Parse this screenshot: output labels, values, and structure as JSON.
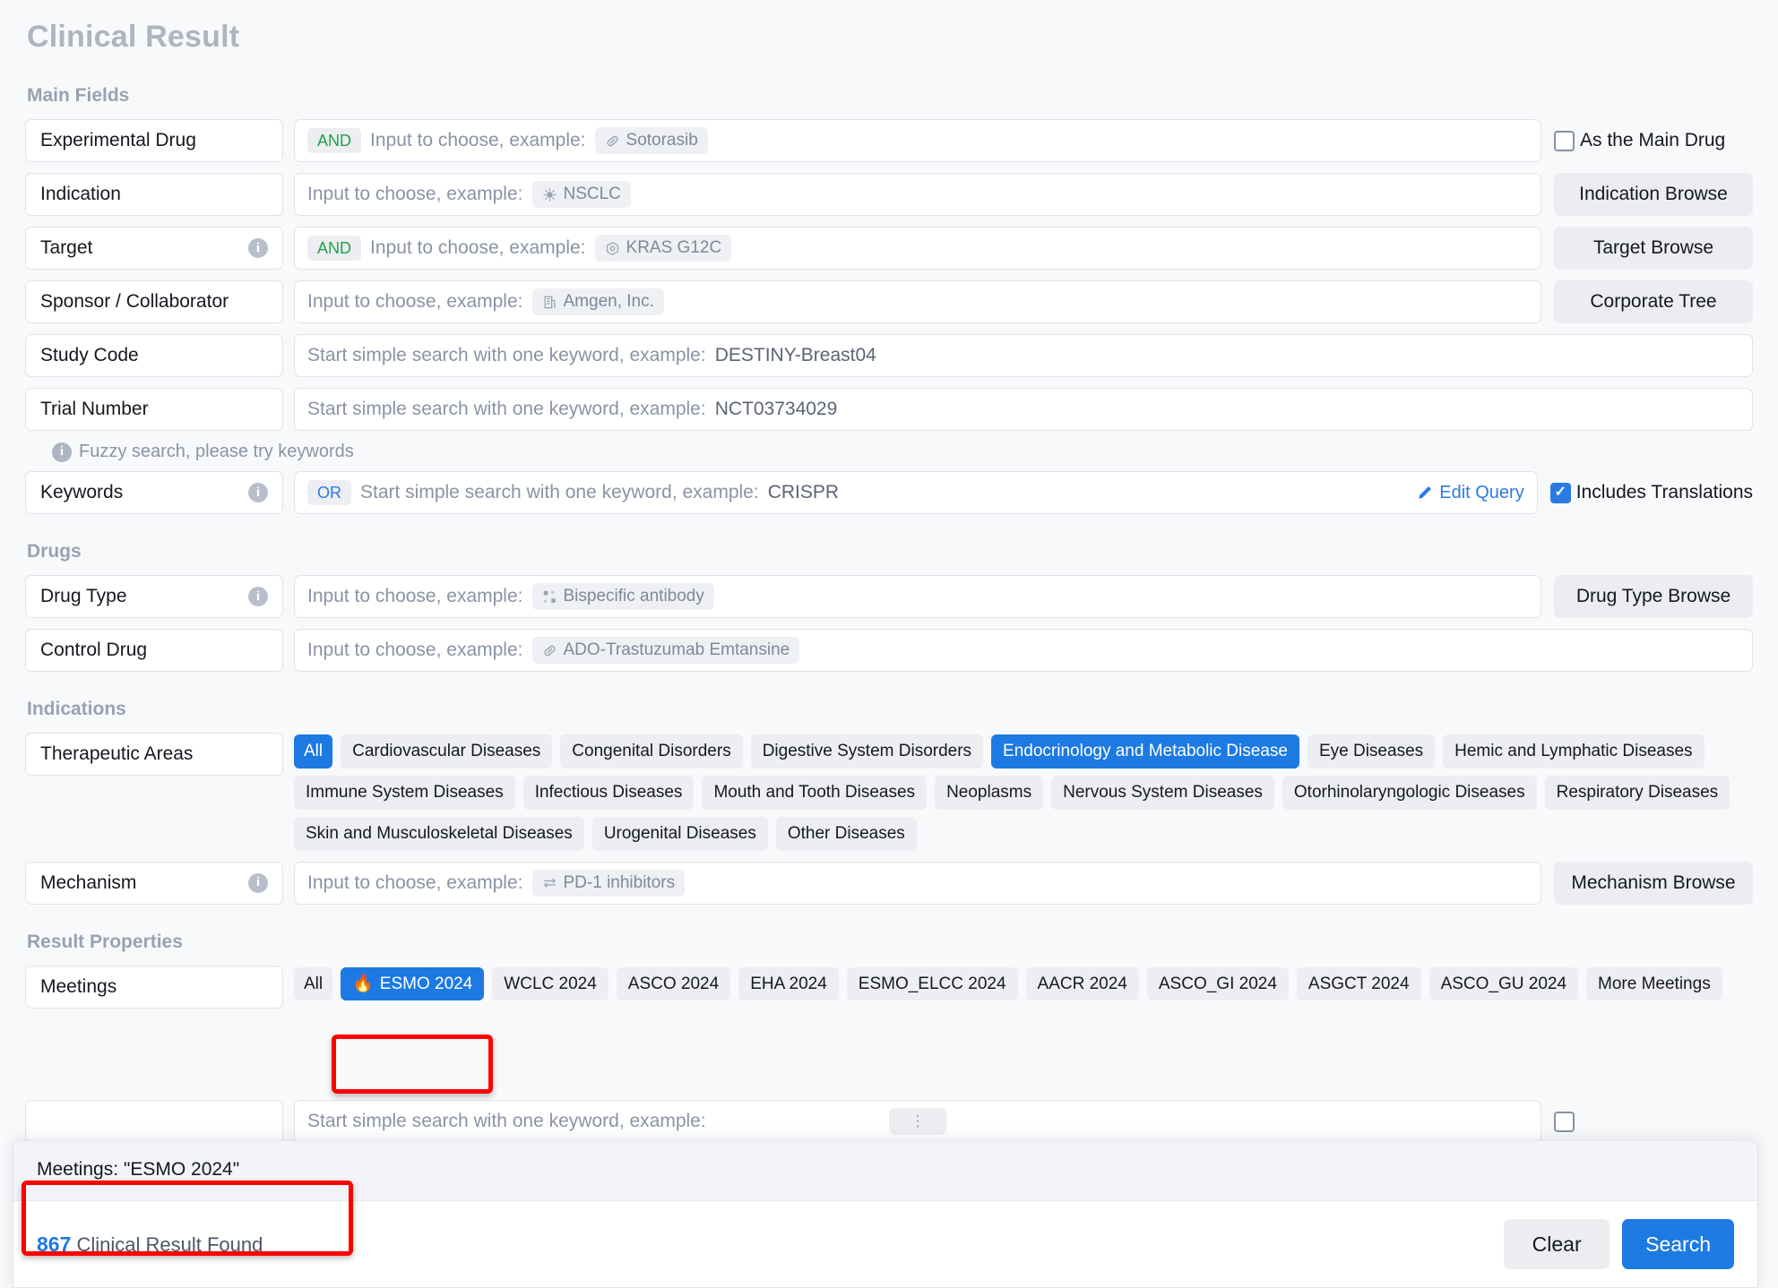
{
  "page": {
    "title": "Clinical Result"
  },
  "sections": {
    "main_fields": {
      "title": "Main Fields"
    },
    "drugs": {
      "title": "Drugs"
    },
    "indications": {
      "title": "Indications"
    },
    "result_properties": {
      "title": "Result Properties"
    }
  },
  "common": {
    "input_to_choose": "Input to choose, example:",
    "simple_search": "Start simple search with one keyword, example:",
    "info_icon": "info-icon"
  },
  "fields": {
    "experimental_drug": {
      "label": "Experimental Drug",
      "logic": "AND",
      "placeholder": "Input to choose, example:",
      "example": "Sotorasib",
      "example_icon": "pill-icon",
      "checkbox_label": "As the Main Drug",
      "checkbox_checked": false
    },
    "indication": {
      "label": "Indication",
      "placeholder": "Input to choose, example:",
      "example": "NSCLC",
      "example_icon": "virus-icon",
      "button": "Indication Browse"
    },
    "target": {
      "label": "Target",
      "logic": "AND",
      "placeholder": "Input to choose, example:",
      "example": "KRAS G12C",
      "example_icon": "target-icon",
      "button": "Target Browse"
    },
    "sponsor": {
      "label": "Sponsor / Collaborator",
      "placeholder": "Input to choose, example:",
      "example": "Amgen, Inc.",
      "example_icon": "building-icon",
      "button": "Corporate Tree"
    },
    "study_code": {
      "label": "Study Code",
      "placeholder": "Start simple search with one keyword, example:",
      "example": "DESTINY-Breast04"
    },
    "trial_number": {
      "label": "Trial Number",
      "placeholder": "Start simple search with one keyword, example:",
      "example": "NCT03734029"
    },
    "fuzzy_hint": "Fuzzy search, please try keywords",
    "keywords": {
      "label": "Keywords",
      "logic": "OR",
      "placeholder": "Start simple search with one keyword, example:",
      "example": "CRISPR",
      "edit_query": "Edit Query",
      "checkbox_label": "Includes Translations",
      "checkbox_checked": true
    },
    "drug_type": {
      "label": "Drug Type",
      "placeholder": "Input to choose, example:",
      "example": "Bispecific antibody",
      "example_icon": "molecule-icon",
      "button": "Drug Type Browse"
    },
    "control_drug": {
      "label": "Control Drug",
      "placeholder": "Input to choose, example:",
      "example": "ADO-Trastuzumab Emtansine",
      "example_icon": "pill-icon"
    },
    "therapeutic_areas": {
      "label": "Therapeutic Areas"
    },
    "mechanism": {
      "label": "Mechanism",
      "placeholder": "Input to choose, example:",
      "example": "PD-1 inhibitors",
      "example_icon": "equilibrium-icon",
      "button": "Mechanism Browse"
    },
    "meetings": {
      "label": "Meetings"
    }
  },
  "therapeutic_area_tags": [
    {
      "label": "All",
      "active": true
    },
    {
      "label": "Cardiovascular Diseases",
      "active": false
    },
    {
      "label": "Congenital Disorders",
      "active": false
    },
    {
      "label": "Digestive System Disorders",
      "active": false
    },
    {
      "label": "Endocrinology and Metabolic Disease",
      "active": true
    },
    {
      "label": "Eye Diseases",
      "active": false
    },
    {
      "label": "Hemic and Lymphatic Diseases",
      "active": false
    },
    {
      "label": "Immune System Diseases",
      "active": false
    },
    {
      "label": "Infectious Diseases",
      "active": false
    },
    {
      "label": "Mouth and Tooth Diseases",
      "active": false
    },
    {
      "label": "Neoplasms",
      "active": false
    },
    {
      "label": "Nervous System Diseases",
      "active": false
    },
    {
      "label": "Otorhinolaryngologic Diseases",
      "active": false
    },
    {
      "label": "Respiratory Diseases",
      "active": false
    },
    {
      "label": "Skin and Musculoskeletal Diseases",
      "active": false
    },
    {
      "label": "Urogenital Diseases",
      "active": false
    },
    {
      "label": "Other Diseases",
      "active": false
    }
  ],
  "meeting_tags": [
    {
      "label": "All",
      "active": false,
      "icon": ""
    },
    {
      "label": "ESMO 2024",
      "active": true,
      "icon": "fire-icon"
    },
    {
      "label": "WCLC 2024",
      "active": false,
      "icon": ""
    },
    {
      "label": "ASCO 2024",
      "active": false,
      "icon": ""
    },
    {
      "label": "EHA 2024",
      "active": false,
      "icon": ""
    },
    {
      "label": "ESMO_ELCC 2024",
      "active": false,
      "icon": ""
    },
    {
      "label": "AACR 2024",
      "active": false,
      "icon": ""
    },
    {
      "label": "ASCO_GI 2024",
      "active": false,
      "icon": ""
    },
    {
      "label": "ASGCT 2024",
      "active": false,
      "icon": ""
    },
    {
      "label": "ASCO_GU 2024",
      "active": false,
      "icon": ""
    },
    {
      "label": "More Meetings",
      "active": false,
      "icon": ""
    }
  ],
  "overlay": {
    "filter_summary": "Meetings: \"ESMO 2024\"",
    "result_count": "867",
    "result_text": "Clinical Result Found",
    "clear_label": "Clear",
    "search_label": "Search"
  },
  "colors": {
    "accent": "#1d7ae3",
    "link": "#2c7be5",
    "and_green": "#22a24a",
    "annotation_red": "#ff0000",
    "tag_bg": "#eceef2",
    "muted_title": "#aeb4c0"
  }
}
